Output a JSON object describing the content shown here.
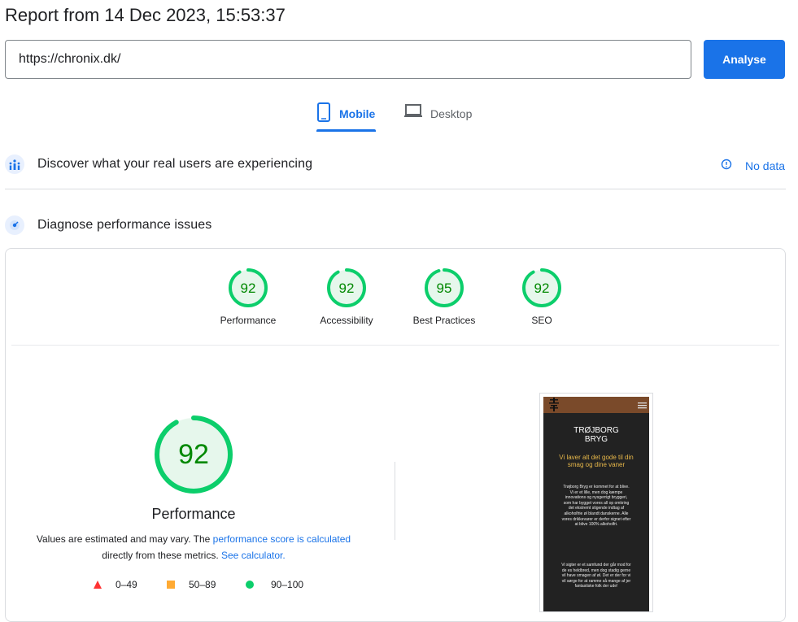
{
  "report": {
    "title": "Report from 14 Dec 2023, 15:53:37"
  },
  "search": {
    "url": "https://chronix.dk/",
    "analyse_label": "Analyse"
  },
  "tabs": [
    {
      "label": "Mobile"
    },
    {
      "label": "Desktop"
    }
  ],
  "sections": {
    "real_users": {
      "title": "Discover what your real users are experiencing",
      "no_data": "No data"
    },
    "diagnose": {
      "title": "Diagnose performance issues"
    }
  },
  "scores": [
    {
      "label": "Performance",
      "value": "92",
      "score": 92
    },
    {
      "label": "Accessibility",
      "value": "92",
      "score": 92
    },
    {
      "label": "Best Practices",
      "value": "95",
      "score": 95
    },
    {
      "label": "SEO",
      "value": "92",
      "score": 92
    }
  ],
  "performance": {
    "value": "92",
    "score": 92,
    "label": "Performance",
    "explain_prefix": "Values are estimated and may vary. The ",
    "explain_link": "performance score is calculated",
    "explain_middle": " directly from these metrics. ",
    "calculator_link": "See calculator.",
    "explain_suffix": ""
  },
  "legend": [
    {
      "range": "0–49",
      "shape": "triangle",
      "color": "#ff3333"
    },
    {
      "range": "50–89",
      "shape": "square",
      "color": "#ffaa33"
    },
    {
      "range": "90–100",
      "shape": "circle",
      "color": "#0cce6b"
    }
  ],
  "colors": {
    "accent": "#1a73e8",
    "pass": "#0cce6b",
    "pass_fill": "#e6f7ec",
    "pass_text": "#008800"
  },
  "screenshot": {
    "heading_line1": "TRØJBORG",
    "heading_line2": "BRYG",
    "tagline": "Vi laver alt det gode til din smag og dine vaner",
    "paragraph1": "Trøjborg Bryg er kommet for at blive. Vi er et lille, men dog kæmpe innovations og nysgerrigt bryggeri, som har bygget vores all op omkring det ekstremt stigende indtag af alkoholfrie øl blandt danskerne. Alle vores drikkevarer er derfor signet efter at blive 100% alkoholfri.",
    "paragraph2": "Vi sigter er et samfund der går mod for de es heldbred, men dog stadig gerne vil have smagen af øl. Det er der for vi vil sørge for at ramme så mange af jer fantastiske folk der ude!"
  }
}
